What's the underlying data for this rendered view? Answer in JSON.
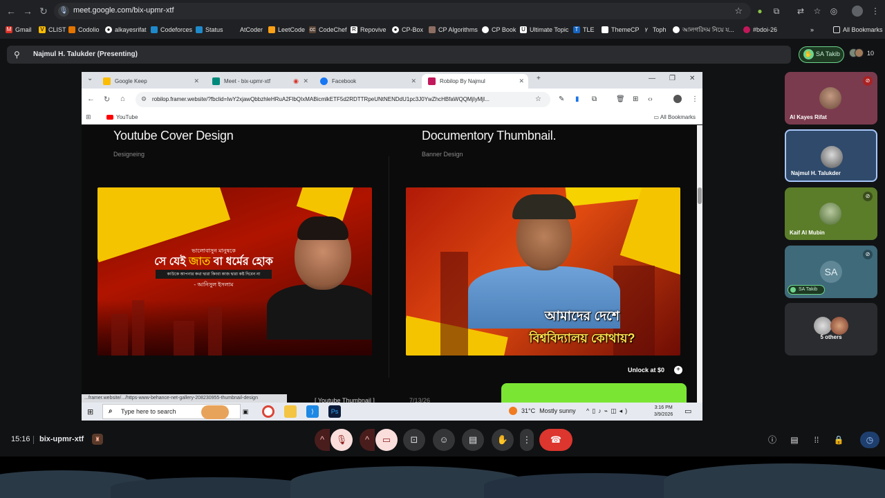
{
  "browser": {
    "url": "meet.google.com/bix-upmr-xtf",
    "bookmarks": [
      "Gmail",
      "CLIST",
      "Codolio",
      "alkayesrifat",
      "Codeforces",
      "Status",
      "AtCoder",
      "LeetCode",
      "CodeChef",
      "Repovive",
      "CP-Box",
      "CP Algorithms",
      "CP Book",
      "Ultimate Topic",
      "TLE",
      "ThemeCP",
      "Toph",
      "আলগরিদম নিয়ে য...",
      "#bdoi-26"
    ],
    "all_bookmarks": "All Bookmarks"
  },
  "presenting": {
    "title": "Najmul H. Talukder (Presenting)"
  },
  "top_right": {
    "hand_raised_name": "SA Takib",
    "participant_count": "10"
  },
  "shared": {
    "tabs": [
      {
        "title": "Google Keep",
        "color": "#fbbc04"
      },
      {
        "title": "Meet - bix-upmr-xtf",
        "color": "#00897b"
      },
      {
        "title": "Facebook",
        "color": "#1877f2"
      },
      {
        "title": "Robilop By Najmul",
        "color": "#c2185b"
      }
    ],
    "url": "robilop.framer.website/?fbclid=IwY2xjawQbbzhleHRuA2FlbQIxMABicmlkETF5d2RDTTRpeUNtNENDdU1pc3J0YwZhcHBfaWQQMjIyMjI...",
    "bookmark_youtube": "YouTube",
    "all_bookmarks": "All Bookmarks",
    "card1": {
      "title": "Youtube Cover Design",
      "subtitle": "Designeing",
      "quote_line1": "ভালোবাসুন মানুষকে",
      "quote_line2a": "সে যেই",
      "quote_line2b": "জাত",
      "quote_line2c": "বা ধর্মের হোক",
      "quote_line3": "কাউকে আপনার কথা দ্বারা কিংবা কাজ দ্বারা কষ্ট দিবেন না",
      "quote_author": "- আনিসুল ইসলাম"
    },
    "card2": {
      "title": "Documentory Thumbnail.",
      "subtitle": "Banner Design",
      "banner_line1": "আমাদের দেশে",
      "banner_line2": "বিশ্ববিদ্যালয় কোথায়?"
    },
    "unlock": "Unlock at $0",
    "status_link": "...framer.website/.../https-www-behance-net-gallery-208230955-thumbnail-design",
    "bottom_label": "[ Youtube Thumbnail ]",
    "bottom_date": "7/13/26",
    "taskbar": {
      "search_placeholder": "Type here to search",
      "temperature": "31°C",
      "weather": "Mostly sunny",
      "time": "3:16 PM",
      "date": "3/9/2026"
    }
  },
  "participants": [
    {
      "name": "Al Kayes Rifat",
      "muted": true
    },
    {
      "name": "Najmul H. Talukder",
      "muted": false
    },
    {
      "name": "Kaif Al Mubin",
      "muted": true
    },
    {
      "name": "SA Takib",
      "initials": "SA",
      "muted": true,
      "hand_raised": true
    },
    {
      "name": "5 others"
    }
  ],
  "meeting": {
    "time": "15:16",
    "code": "bix-upmr-xtf"
  },
  "colors": {
    "accent_green": "#6dd58c",
    "end_call": "#dc362e",
    "muted_bg": "#f9dedc",
    "active_tile_border": "#a8c7fa"
  }
}
